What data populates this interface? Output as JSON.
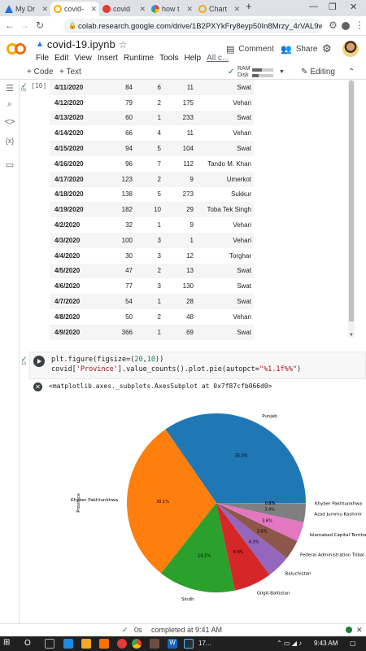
{
  "browser": {
    "tabs": [
      {
        "label": "My Dr",
        "icon": "google-drive-icon",
        "color": "#1a73e8"
      },
      {
        "label": "covid-",
        "icon": "colab-icon",
        "color": "#f9ab00",
        "active": true
      },
      {
        "label": "covid",
        "icon": "kaggle-icon",
        "color": "#e53935"
      },
      {
        "label": "how t",
        "icon": "google-icon",
        "color": "#4285f4"
      },
      {
        "label": "Chart",
        "icon": "colab-icon",
        "color": "#f9ab00"
      }
    ],
    "new_tab": "+",
    "url": "colab.research.google.com/drive/1B2PXYkFry8eyp50In8Mrzy_4rVAL9wlY#scr..."
  },
  "colab": {
    "notebook_title": "covid-19.ipynb",
    "menu": [
      "File",
      "Edit",
      "View",
      "Insert",
      "Runtime",
      "Tools",
      "Help",
      "All c..."
    ],
    "comment_label": "Comment",
    "share_label": "Share",
    "toolbar": {
      "add_code": "+ Code",
      "add_text": "+ Text",
      "ram_label": "RAM",
      "disk_label": "Disk",
      "ram_fill": 0.45,
      "disk_fill": 0.3,
      "editing_label": "Editing"
    }
  },
  "cell1": {
    "exec_count": "[10]",
    "rows": [
      [
        "4/11/2020",
        "84",
        "6",
        "11",
        "Swat"
      ],
      [
        "4/12/2020",
        "79",
        "2",
        "175",
        "Vehari"
      ],
      [
        "4/13/2020",
        "60",
        "1",
        "233",
        "Swat"
      ],
      [
        "4/14/2020",
        "66",
        "4",
        "11",
        "Vehari"
      ],
      [
        "4/15/2020",
        "94",
        "5",
        "104",
        "Swat"
      ],
      [
        "4/16/2020",
        "96",
        "7",
        "112",
        "Tando M. Khan"
      ],
      [
        "4/17/2020",
        "123",
        "2",
        "9",
        "Umerkot"
      ],
      [
        "4/18/2020",
        "138",
        "5",
        "273",
        "Sukkur"
      ],
      [
        "4/19/2020",
        "182",
        "10",
        "29",
        "Toba Tek Singh"
      ],
      [
        "4/2/2020",
        "32",
        "1",
        "9",
        "Vehari"
      ],
      [
        "4/3/2020",
        "100",
        "3",
        "1",
        "Vehari"
      ],
      [
        "4/4/2020",
        "30",
        "3",
        "12",
        "Torghar"
      ],
      [
        "4/5/2020",
        "47",
        "2",
        "13",
        "Swat"
      ],
      [
        "4/6/2020",
        "77",
        "3",
        "130",
        "Swat"
      ],
      [
        "4/7/2020",
        "54",
        "1",
        "28",
        "Swat"
      ],
      [
        "4/8/2020",
        "50",
        "2",
        "48",
        "Vehari"
      ],
      [
        "4/9/2020",
        "366",
        "1",
        "69",
        "Swat"
      ]
    ]
  },
  "cell2": {
    "exec_time": "1s",
    "code_line1_a": "plt.figure(figsize=(",
    "code_line1_n1": "20",
    "code_line1_b": ",",
    "code_line1_n2": "10",
    "code_line1_c": "))",
    "code_line2_a": "covid[",
    "code_line2_s1": "'Province'",
    "code_line2_b": "].value_counts().plot.pie(autopct=",
    "code_line2_s2": "\"%1.1f%%\"",
    "code_line2_c": ")",
    "output_text": "<matplotlib.axes._subplots.AxesSubplot at 0x7f87cfb066d0>"
  },
  "chart_data": {
    "type": "pie",
    "ylabel": "Province",
    "slices": [
      {
        "label": "Punjab",
        "value": 35.0,
        "pct_label": "35.0%",
        "color": "#1f77b4"
      },
      {
        "label": "Khyber Pakhtunkhwa",
        "value": 30.1,
        "pct_label": "30.1%",
        "color": "#ff7f0e"
      },
      {
        "label": "Sindh",
        "value": 14.1,
        "pct_label": "14.1%",
        "color": "#2ca02c"
      },
      {
        "label": "Gilgit-Baltistan",
        "value": 6.9,
        "pct_label": "6.9%",
        "color": "#d62728"
      },
      {
        "label": "Baluchistan",
        "value": 4.3,
        "pct_label": "4.3%",
        "color": "#9467bd"
      },
      {
        "label": "Federal Administration Tribal Area",
        "value": 3.6,
        "pct_label": "3.6%",
        "color": "#8c564b"
      },
      {
        "label": "Islamabad Capital Territory",
        "value": 3.6,
        "pct_label": "3.6%",
        "color": "#e377c2"
      },
      {
        "label": "Azad Jummu Kashmir",
        "value": 3.4,
        "pct_label": "3.4%",
        "color": "#7f7f7f"
      },
      {
        "label": "Khyber Pakhtunkhwa ",
        "value": 0.1,
        "pct_label": "0.1%",
        "color": "#bcbd22"
      },
      {
        "label": "",
        "value": 0.0,
        "pct_label": "0.0%",
        "color": "#17becf"
      }
    ]
  },
  "status": {
    "check": "✓",
    "time": "0s",
    "text": "completed at 9:41 AM",
    "close": "✕"
  },
  "taskbar": {
    "search_label": "O",
    "clock": "9:43 AM",
    "app_label": "17..."
  }
}
